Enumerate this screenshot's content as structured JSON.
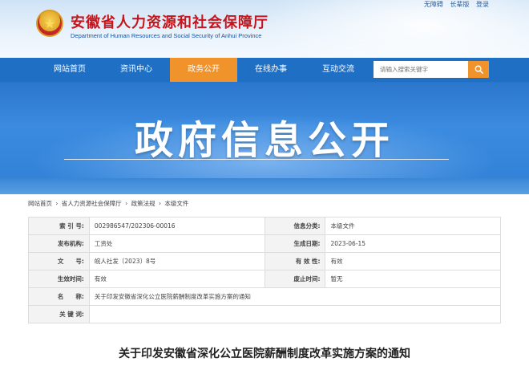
{
  "header": {
    "title": "安徽省人力资源和社会保障厅",
    "subtitle": "Department of Human Resources and Social Security of Anhui Province",
    "top_links": [
      "无障碍",
      "长辈版",
      "登录"
    ]
  },
  "nav": {
    "items": [
      {
        "label": "网站首页"
      },
      {
        "label": "资讯中心"
      },
      {
        "label": "政务公开"
      },
      {
        "label": "在线办事"
      },
      {
        "label": "互动交流"
      }
    ],
    "active_index": 2,
    "search_placeholder": "请输入搜索关键字"
  },
  "banner": {
    "title": "政府信息公开"
  },
  "breadcrumb": [
    "网站首页",
    "›",
    "省人力资源社会保障厅",
    "›",
    "政策法规",
    "›",
    "本级文件"
  ],
  "meta": {
    "rows": [
      {
        "l1": "索 引 号:",
        "v1": "002986547/202306-00016",
        "l2": "信息分类:",
        "v2": "本级文件"
      },
      {
        "l1": "发布机构:",
        "v1": "工资处",
        "l2": "生成日期:",
        "v2": "2023-06-15"
      },
      {
        "l1": "文　　号:",
        "v1": "皖人社发〔2023〕8号",
        "l2": "有 效 性:",
        "v2": "有效"
      },
      {
        "l1": "生效时间:",
        "v1": "有效",
        "l2": "废止时间:",
        "v2": "暂无"
      },
      {
        "l1": "名　　称:",
        "v1": "关于印发安徽省深化公立医院薪酬制度改革实施方案的通知"
      },
      {
        "l1": "关 键 词:",
        "v1": ""
      }
    ]
  },
  "document": {
    "title": "关于印发安徽省深化公立医院薪酬制度改革实施方案的通知"
  },
  "colors": {
    "nav_bg": "#1f6fc5",
    "nav_active": "#f0932b",
    "title_red": "#c4161c",
    "banner_blue": "#2f80d6"
  },
  "icons": {
    "emblem": "national-emblem-icon",
    "search": "search-icon"
  }
}
